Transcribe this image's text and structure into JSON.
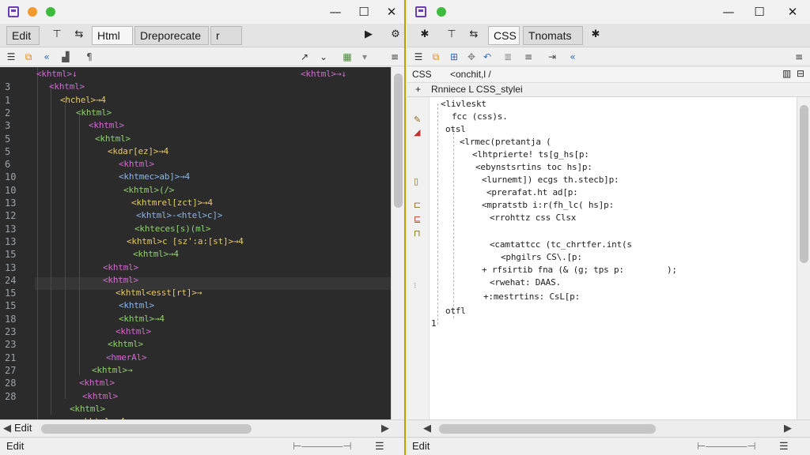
{
  "left": {
    "tabs": [
      "Edit",
      "Html",
      "Dreporecate",
      "r"
    ],
    "status_label": "Edit",
    "bottom_label": "Edit",
    "gutter_lines": [
      "3",
      "1",
      "2",
      "3",
      "5",
      "5",
      "6",
      "10",
      "10",
      "13",
      "12",
      "13",
      "13",
      "15",
      "13",
      "24",
      "15",
      "15",
      "18",
      "23",
      "23",
      "21",
      "27",
      "28",
      "28"
    ],
    "first_line": "<khtml>↓",
    "first_line_right": "<khtml>→↓",
    "code": [
      "<khtml>",
      "<hchel>→4",
      "<khtml>",
      "<khtml>",
      "<khtml>",
      "<kdar[ez]>→4",
      "<khtml>",
      "<khtmec>ab]>→4",
      "<khtml>(/>",
      "<khtmrel[zct]>→4",
      "<khtml>-<htel>c]>",
      "<khteces[s)(ml>",
      "<khtml>c [sz':a:[st]>→4",
      "<khtml>→4",
      "<khtml>",
      "<khtml>",
      "<khtml<esst[rt]>→",
      "<khtml>",
      "<khtml>→4",
      "<khtml>",
      "<khtml>",
      "<hmerAl>",
      "<khtml>→",
      "<khtml>",
      "<khtml>",
      "<khtml>",
      "<khtml>→4"
    ]
  },
  "right": {
    "tabs": [
      "CSS",
      "Tnomats"
    ],
    "status_label": "Edit",
    "path_left": "CSS",
    "path_mid": "<onchit,l /",
    "sub_label": "Rnniece L CSS_stylei",
    "code": [
      "<livleskt",
      "fcc (css)s.",
      "otsl",
      "<lrmec(pretantja (",
      "<lhtprierte! ts[g_hs[p:",
      "<ebynstsrtins toc hs]p:",
      "<lurnemt]) ecgs th.stecb]p:",
      "<prerafat.ht ad[p:",
      "<mpratstb i:r(fh_lc( hs]p:",
      "<rrohttz css Clsx",
      "<camtattcc (tc_chrtfer.int(s",
      "<phgilrs CS\\.[p:",
      "+ rfsirtib fna (& (g; tps p:",
      "<rwehat: DAAS.",
      "+:mestrtins: CsL[p:",
      "otfl",
      "1"
    ],
    "code_tail": ");"
  }
}
